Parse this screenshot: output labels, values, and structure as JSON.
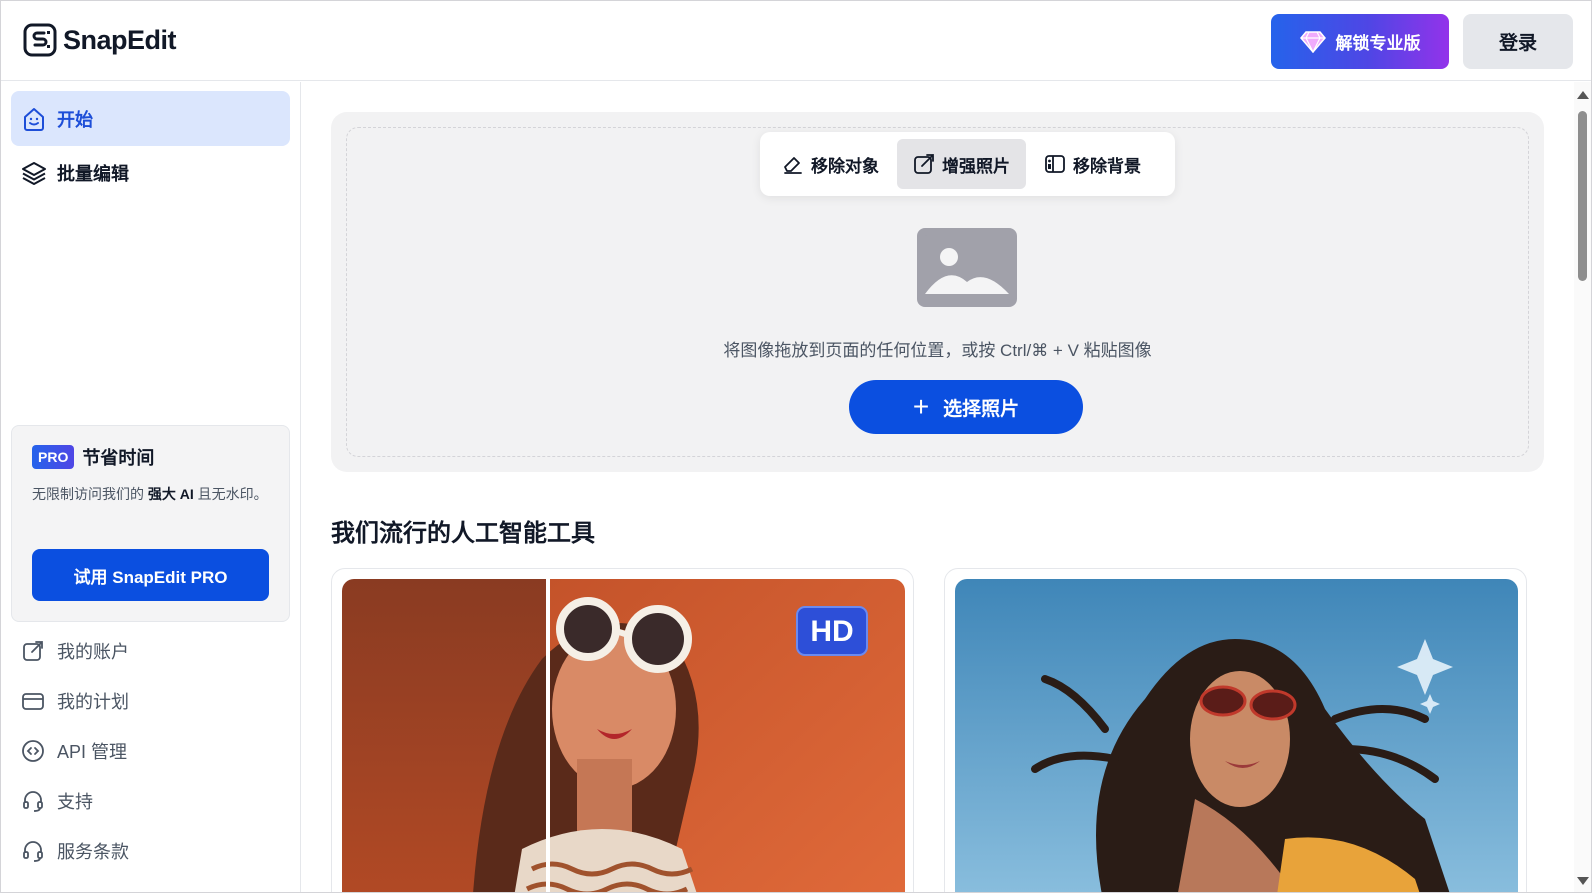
{
  "header": {
    "brand": "SnapEdit",
    "pro_button": "解锁专业版",
    "login_button": "登录"
  },
  "sidebar": {
    "nav": [
      {
        "label": "开始",
        "icon": "smile-icon",
        "active": true
      },
      {
        "label": "批量编辑",
        "icon": "layers-icon",
        "active": false
      }
    ],
    "promo": {
      "badge": "PRO",
      "title": "节省时间",
      "desc_prefix": "无限制访问我们的 ",
      "desc_bold": "强大 AI",
      "desc_suffix": " 且无水印。",
      "button": "试用 SnapEdit PRO"
    },
    "links": [
      {
        "label": "我的账户",
        "icon": "external-link-icon"
      },
      {
        "label": "我的计划",
        "icon": "credit-card-icon"
      },
      {
        "label": "API 管理",
        "icon": "code-icon"
      },
      {
        "label": "支持",
        "icon": "headset-icon"
      },
      {
        "label": "服务条款",
        "icon": "headset-icon"
      }
    ]
  },
  "main": {
    "tabs": [
      {
        "label": "移除对象",
        "icon": "eraser-icon",
        "active": false
      },
      {
        "label": "增强照片",
        "icon": "enhance-icon",
        "active": true
      },
      {
        "label": "移除背景",
        "icon": "background-icon",
        "active": false
      }
    ],
    "drop_hint": "将图像拖放到页面的任何位置，或按 Ctrl/⌘ + V 粘贴图像",
    "select_button": "选择照片",
    "section_title": "我们流行的人工智能工具",
    "cards": [
      {
        "name": "enhance-photo-card",
        "badge": "HD"
      },
      {
        "name": "sky-replace-card"
      }
    ]
  },
  "colors": {
    "primary": "#0b4fe0",
    "active_nav_bg": "#dbe6fd",
    "panel_bg": "#f2f2f3"
  }
}
